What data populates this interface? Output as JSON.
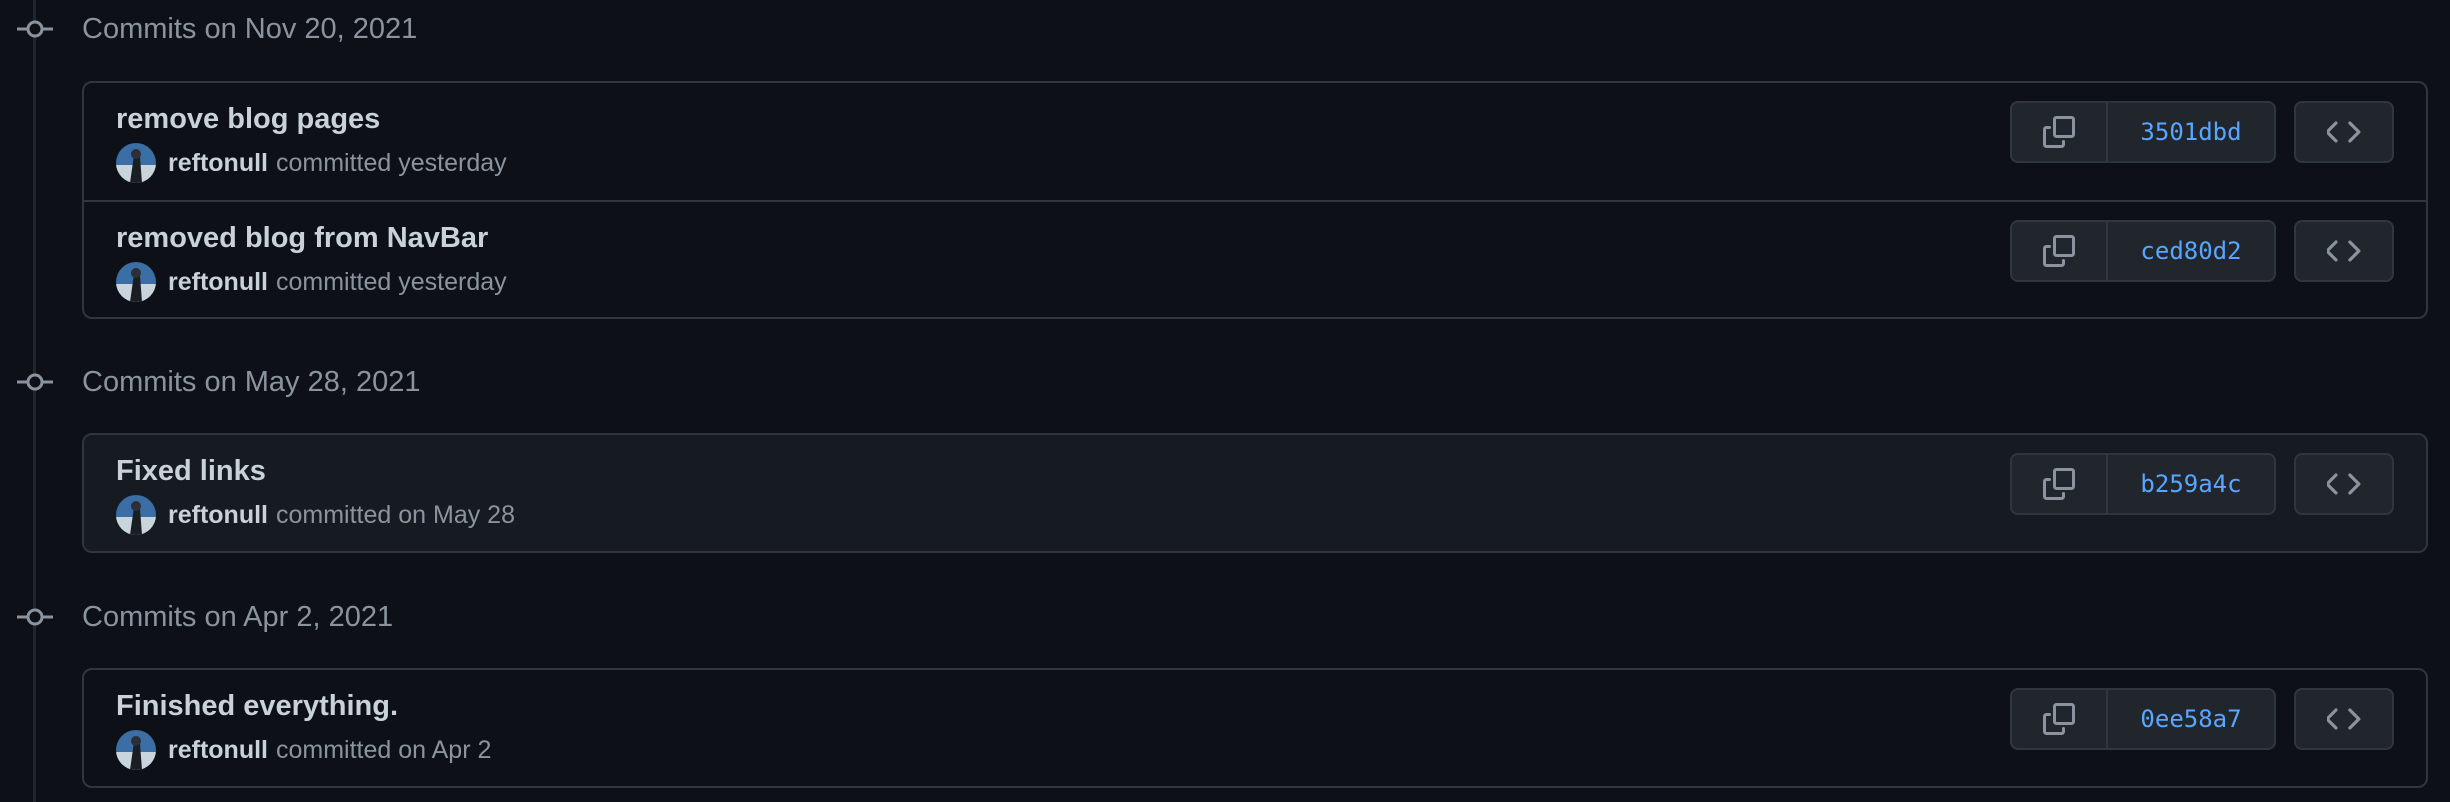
{
  "colors": {
    "background": "#0d1117",
    "border": "#30363d",
    "muted_text": "#8b949e",
    "text": "#c9d1d9",
    "link": "#58a6ff",
    "button_bg": "#21262d"
  },
  "groups": [
    {
      "title": "Commits on Nov 20, 2021",
      "commits": [
        {
          "message": "remove blog pages",
          "author": "reftonull",
          "when": "committed yesterday",
          "sha": "3501dbd"
        },
        {
          "message": "removed blog from NavBar",
          "author": "reftonull",
          "when": "committed yesterday",
          "sha": "ced80d2"
        }
      ]
    },
    {
      "title": "Commits on May 28, 2021",
      "commits": [
        {
          "message": "Fixed links",
          "author": "reftonull",
          "when": "committed on May 28",
          "sha": "b259a4c"
        }
      ]
    },
    {
      "title": "Commits on Apr 2, 2021",
      "commits": [
        {
          "message": "Finished everything.",
          "author": "reftonull",
          "when": "committed on Apr 2",
          "sha": "0ee58a7"
        }
      ]
    }
  ],
  "icons": {
    "timeline": "git-commit-icon",
    "copy": "copy-icon",
    "browse": "code-icon"
  }
}
